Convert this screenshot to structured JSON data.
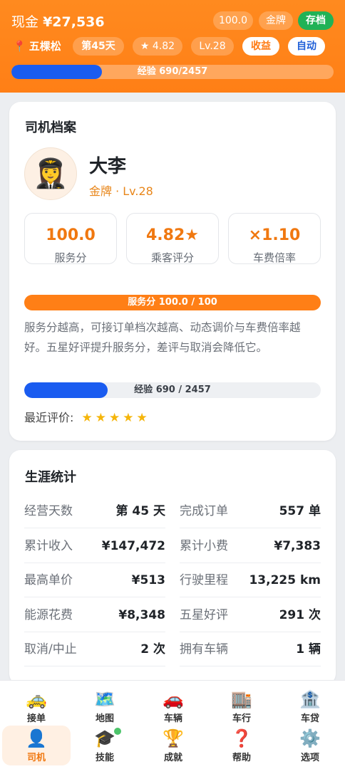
{
  "header": {
    "cash_label": "现金",
    "cash_value": "¥27,536",
    "chip_score": "100.0",
    "chip_rank": "金牌",
    "save_label": "存档",
    "location": "五棵松",
    "day": "第45天",
    "rating": "★ 4.82",
    "level": "Lv.28",
    "earnings_label": "收益",
    "auto_label": "自动",
    "xp_text": "经验 690/2457",
    "xp_progress": 0.281
  },
  "profile": {
    "title": "司机档案",
    "avatar": "👩‍✈️",
    "name": "大李",
    "rank_line": "金牌 · Lv.28",
    "stats": [
      {
        "value": "100.0",
        "label": "服务分"
      },
      {
        "value": "4.82★",
        "label": "乘客评分"
      },
      {
        "value": "×1.10",
        "label": "车费倍率"
      }
    ],
    "service_bar_text": "服务分 100.0 / 100",
    "service_progress": 1.0,
    "description": "服务分越高，可接订单档次越高、动态调价与车费倍率越好。五星好评提升服务分，差评与取消会降低它。",
    "xp_text": "经验 690 / 2457",
    "xp_progress": 0.281,
    "recent_label": "最近评价:",
    "recent_stars": "★★★★★"
  },
  "career": {
    "title": "生涯统计",
    "rows": [
      {
        "k": "经营天数",
        "v": "第 45 天"
      },
      {
        "k": "完成订单",
        "v": "557 单"
      },
      {
        "k": "累计收入",
        "v": "¥147,472"
      },
      {
        "k": "累计小费",
        "v": "¥7,383"
      },
      {
        "k": "最高单价",
        "v": "¥513"
      },
      {
        "k": "行驶里程",
        "v": "13,225 km"
      },
      {
        "k": "能源花费",
        "v": "¥8,348"
      },
      {
        "k": "五星好评",
        "v": "291 次"
      },
      {
        "k": "取消/中止",
        "v": "2 次"
      },
      {
        "k": "拥有车辆",
        "v": "1 辆"
      }
    ]
  },
  "nav": {
    "top": [
      {
        "icon": "🚕",
        "label": "接单"
      },
      {
        "icon": "🗺️",
        "label": "地图"
      },
      {
        "icon": "🚗",
        "label": "车辆"
      },
      {
        "icon": "🏬",
        "label": "车行"
      },
      {
        "icon": "🏦",
        "label": "车贷"
      }
    ],
    "bottom": [
      {
        "icon": "👤",
        "label": "司机"
      },
      {
        "icon": "🎓",
        "label": "技能"
      },
      {
        "icon": "🏆",
        "label": "成就"
      },
      {
        "icon": "❓",
        "label": "帮助"
      },
      {
        "icon": "⚙️",
        "label": "选项"
      }
    ]
  }
}
